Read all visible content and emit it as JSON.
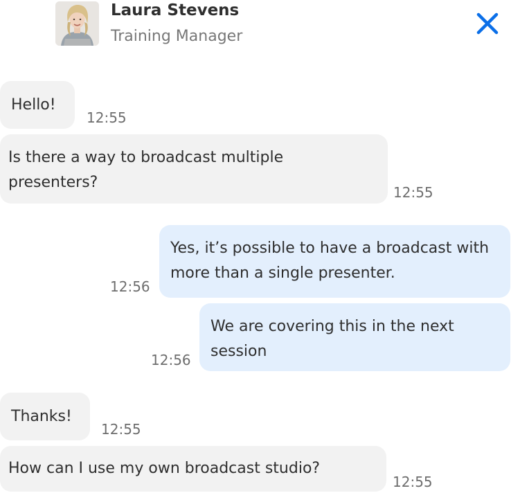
{
  "contact": {
    "name": "Laura Stevens",
    "role": "Training Manager",
    "avatar_icon": "user-avatar-photo"
  },
  "header": {
    "close_icon": "close-x-icon",
    "accent_color": "#0b6fe8"
  },
  "messages": [
    {
      "direction": "incoming",
      "text": "Hello!",
      "time": "12:55"
    },
    {
      "direction": "incoming",
      "text": "Is there a way to broadcast multiple presenters?",
      "time": "12:55"
    },
    {
      "direction": "outgoing",
      "text": "Yes, it’s possible to have a broadcast with more than a single presenter.",
      "time": "12:56"
    },
    {
      "direction": "outgoing",
      "text": "We are covering this in the next session",
      "time": "12:56"
    },
    {
      "direction": "incoming",
      "text": "Thanks!",
      "time": "12:55"
    },
    {
      "direction": "incoming",
      "text": "How can I use my own broadcast studio?",
      "time": "12:55"
    }
  ],
  "colors": {
    "incoming_bubble": "#f2f2f2",
    "outgoing_bubble": "#e3effd",
    "timestamp": "#6d6d6d"
  }
}
